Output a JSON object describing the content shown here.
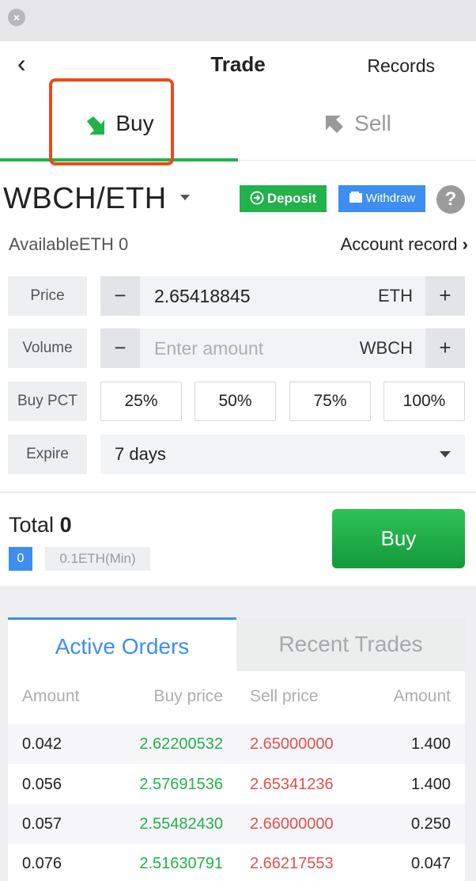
{
  "window": {
    "close_icon": "close-icon"
  },
  "nav": {
    "back_icon": "chevron-left-icon",
    "title": "Trade",
    "records": "Records"
  },
  "tabs": {
    "buy": "Buy",
    "sell": "Sell",
    "buy_icon": "arrow-down-right-icon",
    "sell_icon": "arrow-up-left-icon"
  },
  "pair": {
    "name": "WBCH/ETH",
    "deposit": "Deposit",
    "withdraw": "Withdraw",
    "help": "?"
  },
  "balance": {
    "available": "AvailableETH 0",
    "account_record": "Account record"
  },
  "form": {
    "price_label": "Price",
    "price_value": "2.65418845",
    "price_unit": "ETH",
    "volume_label": "Volume",
    "volume_placeholder": "Enter amount",
    "volume_unit": "WBCH",
    "minus": "−",
    "plus": "+",
    "buy_pct_label": "Buy PCT",
    "pct_options": [
      "25%",
      "50%",
      "75%",
      "100%"
    ],
    "expire_label": "Expire",
    "expire_value": "7 days"
  },
  "summary": {
    "total_label": "Total",
    "total_value": "0",
    "count_badge": "0",
    "min_note": "0.1ETH(Min)",
    "buy_button": "Buy"
  },
  "orders": {
    "tab_active": "Active Orders",
    "tab_recent": "Recent Trades",
    "columns": [
      "Amount",
      "Buy price",
      "Sell price",
      "Amount"
    ],
    "rows": [
      {
        "amount_buy": "0.042",
        "buy_price": "2.62200532",
        "sell_price": "2.65000000",
        "amount_sell": "1.400"
      },
      {
        "amount_buy": "0.056",
        "buy_price": "2.57691536",
        "sell_price": "2.65341236",
        "amount_sell": "1.400"
      },
      {
        "amount_buy": "0.057",
        "buy_price": "2.55482430",
        "sell_price": "2.66000000",
        "amount_sell": "0.250"
      },
      {
        "amount_buy": "0.076",
        "buy_price": "2.51630791",
        "sell_price": "2.66217553",
        "amount_sell": "0.047"
      }
    ]
  },
  "colors": {
    "green": "#21b24b",
    "red": "#e2504f",
    "blue": "#3d8ef0",
    "highlight": "#ea4a1e"
  }
}
